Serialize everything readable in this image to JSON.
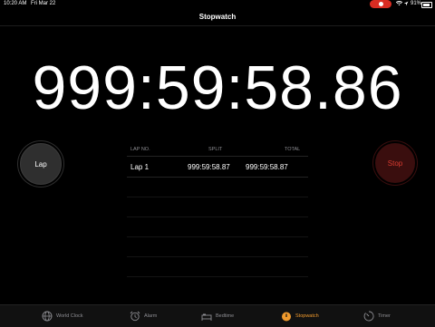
{
  "status": {
    "time": "10:20 AM",
    "date": "Fri Mar 22",
    "battery": "91%"
  },
  "title": "Stopwatch",
  "timer": "999:59:58.86",
  "buttons": {
    "lap": "Lap",
    "stop": "Stop"
  },
  "laps": {
    "headers": [
      "LAP NO.",
      "SPLIT",
      "TOTAL"
    ],
    "rows": [
      {
        "lap": "Lap 1",
        "split": "999:59:58.87",
        "total": "999:59:58.87"
      }
    ]
  },
  "tabs": [
    {
      "label": "World Clock",
      "icon": "globe-icon"
    },
    {
      "label": "Alarm",
      "icon": "alarm-clock-icon"
    },
    {
      "label": "Bedtime",
      "icon": "bed-icon"
    },
    {
      "label": "Stopwatch",
      "icon": "stopwatch-icon",
      "active": true
    },
    {
      "label": "Timer",
      "icon": "timer-icon"
    }
  ],
  "colors": {
    "accent": "#f09a2d",
    "stop": "#d93b30"
  }
}
